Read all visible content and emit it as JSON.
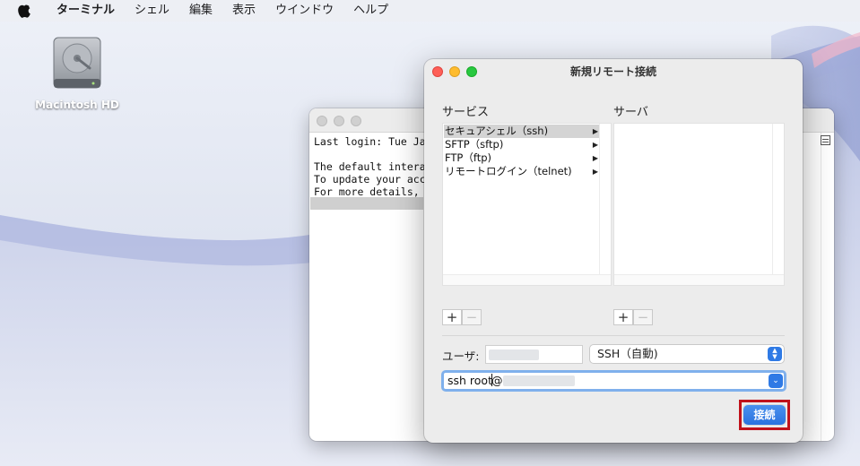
{
  "menubar": {
    "app_name": "ターミナル",
    "items": [
      "シェル",
      "編集",
      "表示",
      "ウインドウ",
      "ヘルプ"
    ]
  },
  "desktop": {
    "disk_label": "Macintosh HD"
  },
  "terminal": {
    "lines": [
      "Last login: Tue Ja",
      "",
      "The default intera",
      "To update your acc",
      "For more details,"
    ]
  },
  "dialog": {
    "title": "新規リモート接続",
    "service_label": "サービス",
    "server_label": "サーバ",
    "services": [
      {
        "label": "セキュアシェル（ssh)",
        "selected": true
      },
      {
        "label": "SFTP（sftp)",
        "selected": false
      },
      {
        "label": "FTP（ftp)",
        "selected": false
      },
      {
        "label": "リモートログイン（telnet)",
        "selected": false
      }
    ],
    "add_symbol": "+",
    "remove_symbol": "−",
    "user_label": "ユーザ:",
    "protocol_select": "SSH（自動)",
    "command_prefix": "ssh root",
    "command_at": "@",
    "connect_label": "接続"
  },
  "colors": {
    "accent": "#2f7ae5",
    "highlight_border": "#c0121b",
    "selection": "#d4d4d4"
  }
}
